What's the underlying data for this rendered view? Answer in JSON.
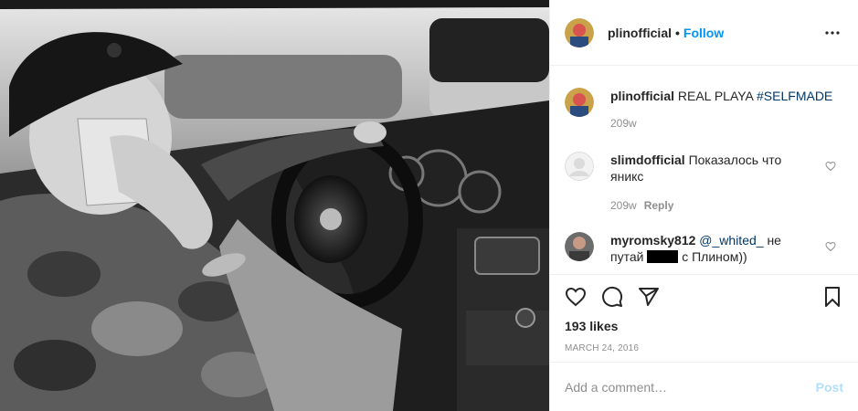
{
  "post": {
    "username": "plinofficial",
    "follow_label": "Follow",
    "separator": "•",
    "more_icon": "more-horizontal-icon"
  },
  "caption": {
    "username": "plinofficial",
    "text": "REAL PLAYA",
    "hashtag": "#SELFMADE",
    "time": "209w"
  },
  "comments": [
    {
      "username": "slimdofficial",
      "text": "Показалось что яникс",
      "time": "209w",
      "reply_label": "Reply"
    },
    {
      "username": "myromsky812",
      "mention": "@_whited_",
      "text_before": "не путай",
      "text_after": "с Плином))"
    }
  ],
  "actions": {
    "likes": "193 likes",
    "date": "MARCH 24, 2016"
  },
  "add_comment": {
    "placeholder": "Add a comment…",
    "post_label": "Post"
  },
  "colors": {
    "link_blue": "#0095f6",
    "post_disabled": "#b2dffc",
    "meta_gray": "#8e8e8e"
  }
}
